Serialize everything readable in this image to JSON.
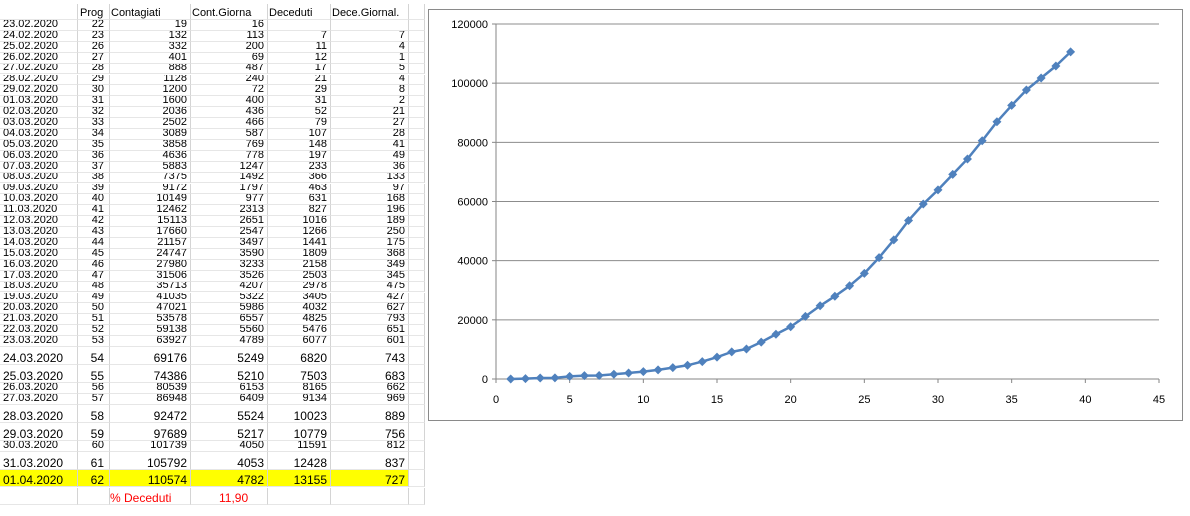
{
  "sheet": {
    "headers": {
      "prog": "Prog",
      "contagiati": "Contagiati",
      "cont_giorna": "Cont.Giorna",
      "deceduti": "Deceduti",
      "dece_giornal": "Dece.Giornal."
    },
    "rows": [
      {
        "date": "23.02.2020",
        "prog": "22",
        "cont": "19",
        "cg": "16",
        "dec": "",
        "dg": ""
      },
      {
        "date": "24.02.2020",
        "prog": "23",
        "cont": "132",
        "cg": "113",
        "dec": "7",
        "dg": "7"
      },
      {
        "date": "25.02.2020",
        "prog": "26",
        "cont": "332",
        "cg": "200",
        "dec": "11",
        "dg": "4"
      },
      {
        "date": "26.02.2020",
        "prog": "27",
        "cont": "401",
        "cg": "69",
        "dec": "12",
        "dg": "1"
      },
      {
        "date": "27.02.2020",
        "prog": "28",
        "cont": "888",
        "cg": "487",
        "dec": "17",
        "dg": "5"
      },
      {
        "date": "28.02.2020",
        "prog": "29",
        "cont": "1128",
        "cg": "240",
        "dec": "21",
        "dg": "4"
      },
      {
        "date": "29.02.2020",
        "prog": "30",
        "cont": "1200",
        "cg": "72",
        "dec": "29",
        "dg": "8"
      },
      {
        "date": "01.03.2020",
        "prog": "31",
        "cont": "1600",
        "cg": "400",
        "dec": "31",
        "dg": "2"
      },
      {
        "date": "02.03.2020",
        "prog": "32",
        "cont": "2036",
        "cg": "436",
        "dec": "52",
        "dg": "21"
      },
      {
        "date": "03.03.2020",
        "prog": "33",
        "cont": "2502",
        "cg": "466",
        "dec": "79",
        "dg": "27"
      },
      {
        "date": "04.03.2020",
        "prog": "34",
        "cont": "3089",
        "cg": "587",
        "dec": "107",
        "dg": "28"
      },
      {
        "date": "05.03.2020",
        "prog": "35",
        "cont": "3858",
        "cg": "769",
        "dec": "148",
        "dg": "41"
      },
      {
        "date": "06.03.2020",
        "prog": "36",
        "cont": "4636",
        "cg": "778",
        "dec": "197",
        "dg": "49"
      },
      {
        "date": "07.03.2020",
        "prog": "37",
        "cont": "5883",
        "cg": "1247",
        "dec": "233",
        "dg": "36"
      },
      {
        "date": "08.03.2020",
        "prog": "38",
        "cont": "7375",
        "cg": "1492",
        "dec": "366",
        "dg": "133"
      },
      {
        "date": "09.03.2020",
        "prog": "39",
        "cont": "9172",
        "cg": "1797",
        "dec": "463",
        "dg": "97"
      },
      {
        "date": "10.03.2020",
        "prog": "40",
        "cont": "10149",
        "cg": "977",
        "dec": "631",
        "dg": "168"
      },
      {
        "date": "11.03.2020",
        "prog": "41",
        "cont": "12462",
        "cg": "2313",
        "dec": "827",
        "dg": "196"
      },
      {
        "date": "12.03.2020",
        "prog": "42",
        "cont": "15113",
        "cg": "2651",
        "dec": "1016",
        "dg": "189"
      },
      {
        "date": "13.03.2020",
        "prog": "43",
        "cont": "17660",
        "cg": "2547",
        "dec": "1266",
        "dg": "250"
      },
      {
        "date": "14.03.2020",
        "prog": "44",
        "cont": "21157",
        "cg": "3497",
        "dec": "1441",
        "dg": "175"
      },
      {
        "date": "15.03.2020",
        "prog": "45",
        "cont": "24747",
        "cg": "3590",
        "dec": "1809",
        "dg": "368"
      },
      {
        "date": "16.03.2020",
        "prog": "46",
        "cont": "27980",
        "cg": "3233",
        "dec": "2158",
        "dg": "349"
      },
      {
        "date": "17.03.2020",
        "prog": "47",
        "cont": "31506",
        "cg": "3526",
        "dec": "2503",
        "dg": "345"
      },
      {
        "date": "18.03.2020",
        "prog": "48",
        "cont": "35713",
        "cg": "4207",
        "dec": "2978",
        "dg": "475"
      },
      {
        "date": "19.03.2020",
        "prog": "49",
        "cont": "41035",
        "cg": "5322",
        "dec": "3405",
        "dg": "427"
      },
      {
        "date": "20.03.2020",
        "prog": "50",
        "cont": "47021",
        "cg": "5986",
        "dec": "4032",
        "dg": "627"
      },
      {
        "date": "21.03.2020",
        "prog": "51",
        "cont": "53578",
        "cg": "6557",
        "dec": "4825",
        "dg": "793"
      },
      {
        "date": "22.03.2020",
        "prog": "52",
        "cont": "59138",
        "cg": "5560",
        "dec": "5476",
        "dg": "651"
      },
      {
        "date": "23.03.2020",
        "prog": "53",
        "cont": "63927",
        "cg": "4789",
        "dec": "6077",
        "dg": "601"
      },
      {
        "date": "24.03.2020",
        "prog": "54",
        "cont": "69176",
        "cg": "5249",
        "dec": "6820",
        "dg": "743"
      },
      {
        "date": "25.03.2020",
        "prog": "55",
        "cont": "74386",
        "cg": "5210",
        "dec": "7503",
        "dg": "683"
      },
      {
        "date": "26.03.2020",
        "prog": "56",
        "cont": "80539",
        "cg": "6153",
        "dec": "8165",
        "dg": "662"
      },
      {
        "date": "27.03.2020",
        "prog": "57",
        "cont": "86948",
        "cg": "6409",
        "dec": "9134",
        "dg": "969"
      },
      {
        "date": "28.03.2020",
        "prog": "58",
        "cont": "92472",
        "cg": "5524",
        "dec": "10023",
        "dg": "889"
      },
      {
        "date": "29.03.2020",
        "prog": "59",
        "cont": "97689",
        "cg": "5217",
        "dec": "10779",
        "dg": "756"
      },
      {
        "date": "30.03.2020",
        "prog": "60",
        "cont": "101739",
        "cg": "4050",
        "dec": "11591",
        "dg": "812"
      },
      {
        "date": "31.03.2020",
        "prog": "61",
        "cont": "105792",
        "cg": "4053",
        "dec": "12428",
        "dg": "837"
      },
      {
        "date": "01.04.2020",
        "prog": "62",
        "cont": "110574",
        "cg": "4782",
        "dec": "13155",
        "dg": "727"
      }
    ],
    "summary": {
      "label": "% Deceduti",
      "value": "11,90"
    },
    "colors": {
      "highlight": "#ffff00",
      "summary_text": "#ff0000"
    }
  },
  "chart_data": {
    "type": "line",
    "x": [
      1,
      2,
      3,
      4,
      5,
      6,
      7,
      8,
      9,
      10,
      11,
      12,
      13,
      14,
      15,
      16,
      17,
      18,
      19,
      20,
      21,
      22,
      23,
      24,
      25,
      26,
      27,
      28,
      29,
      30,
      31,
      32,
      33,
      34,
      35,
      36,
      37,
      38,
      39
    ],
    "series": [
      {
        "values": [
          19,
          132,
          332,
          401,
          888,
          1128,
          1200,
          1600,
          2036,
          2502,
          3089,
          3858,
          4636,
          5883,
          7375,
          9172,
          10149,
          12462,
          15113,
          17660,
          21157,
          24747,
          27980,
          31506,
          35713,
          41035,
          47021,
          53578,
          59138,
          63927,
          69176,
          74386,
          80539,
          86948,
          92472,
          97689,
          101739,
          105792,
          110574
        ],
        "color": "#4f81bd",
        "marker": "diamond"
      }
    ],
    "xlim": [
      0,
      45
    ],
    "ylim": [
      0,
      120000
    ],
    "xticks": [
      0,
      5,
      10,
      15,
      20,
      25,
      30,
      35,
      40,
      45
    ],
    "yticks": [
      0,
      20000,
      40000,
      60000,
      80000,
      100000,
      120000
    ],
    "grid": "horizontal",
    "legend": "none",
    "title": "",
    "xlabel": "",
    "ylabel": ""
  }
}
